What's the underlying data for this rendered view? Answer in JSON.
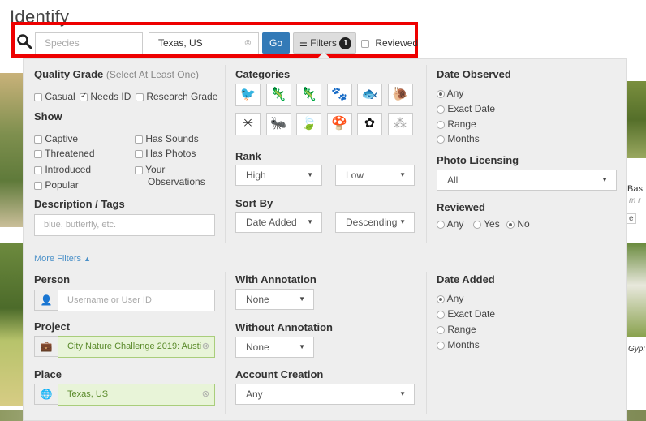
{
  "page_title": "Identify",
  "search": {
    "species_placeholder": "Species",
    "place_value": "Texas, US",
    "go_label": "Go",
    "filters_label": "Filters",
    "filters_count": "1",
    "reviewed_label": "Reviewed"
  },
  "background_side": {
    "bas": "Bas",
    "ital": "m r",
    "box": "e",
    "gyp": "Gyp:"
  },
  "quality": {
    "heading": "Quality Grade",
    "hint": "(Select At Least One)",
    "options": [
      "Casual",
      "Needs ID",
      "Research Grade"
    ],
    "checked": [
      false,
      true,
      false
    ]
  },
  "show": {
    "heading": "Show",
    "col1": [
      "Captive",
      "Threatened",
      "Introduced",
      "Popular"
    ],
    "col2": [
      "Has Sounds",
      "Has Photos",
      "Your",
      "Observations"
    ]
  },
  "description": {
    "heading": "Description / Tags",
    "placeholder": "blue, butterfly, etc."
  },
  "categories": {
    "heading": "Categories",
    "icons": [
      "bird-icon",
      "amphibian-icon",
      "reptile-icon",
      "mammal-icon",
      "fish-icon",
      "mollusk-icon",
      "spider-icon",
      "insect-icon",
      "plant-icon",
      "fungi-icon",
      "protozoa-icon",
      "unknown-icon"
    ],
    "glyphs": [
      "🐦",
      "🦎",
      "🦎",
      "🐾",
      "🐟",
      "🐌",
      "✳",
      "🐜",
      "🍃",
      "🍄",
      "✿",
      "⁂"
    ]
  },
  "rank": {
    "heading": "Rank",
    "high": "High",
    "low": "Low"
  },
  "sort": {
    "heading": "Sort By",
    "field": "Date Added",
    "order": "Descending"
  },
  "date_observed": {
    "heading": "Date Observed",
    "options": [
      "Any",
      "Exact Date",
      "Range",
      "Months"
    ]
  },
  "photo_licensing": {
    "heading": "Photo Licensing",
    "value": "All"
  },
  "reviewed": {
    "heading": "Reviewed",
    "options": [
      "Any",
      "Yes",
      "No"
    ]
  },
  "more_filters": "More Filters",
  "person": {
    "heading": "Person",
    "placeholder": "Username or User ID"
  },
  "project": {
    "heading": "Project",
    "value": "City Nature Challenge 2019: Austi"
  },
  "place": {
    "heading": "Place",
    "value": "Texas, US"
  },
  "with_annotation": {
    "heading": "With Annotation",
    "value": "None"
  },
  "without_annotation": {
    "heading": "Without Annotation",
    "value": "None"
  },
  "account_creation": {
    "heading": "Account Creation",
    "value": "Any"
  },
  "date_added": {
    "heading": "Date Added",
    "options": [
      "Any",
      "Exact Date",
      "Range",
      "Months"
    ]
  }
}
